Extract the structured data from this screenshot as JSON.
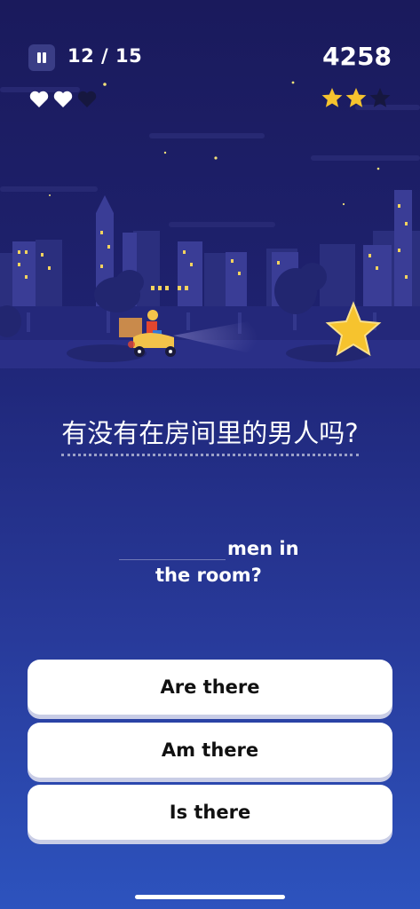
{
  "hud": {
    "progress": "12 / 15",
    "score": "4258",
    "lives_total": 3,
    "lives_remaining": 2,
    "stars_total": 3,
    "stars_earned": 2
  },
  "question": {
    "prompt": "有没有在房间里的男人吗?",
    "sentence_line1": "men in",
    "sentence_line2": "the room?"
  },
  "answers": [
    {
      "label": "Are there"
    },
    {
      "label": "Am there"
    },
    {
      "label": "Is there"
    }
  ],
  "colors": {
    "accent_star": "#f6c32e",
    "heart": "#ffffff",
    "heart_lost": "#16173f"
  }
}
